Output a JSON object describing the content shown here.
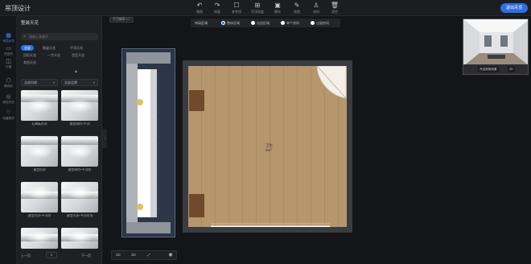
{
  "app": {
    "title": "吊顶设计"
  },
  "toolbar": {
    "tools": [
      {
        "label": "撤销",
        "icon": "undo-icon"
      },
      {
        "label": "恢复",
        "icon": "redo-icon"
      },
      {
        "label": "参考线",
        "icon": "guide-icon"
      },
      {
        "label": "吊顶高度",
        "icon": "height-icon"
      },
      {
        "label": "模块",
        "icon": "module-icon"
      },
      {
        "label": "绘图",
        "icon": "pencil-icon"
      },
      {
        "label": "房间",
        "icon": "user-icon"
      },
      {
        "label": "清空",
        "icon": "trash-icon"
      }
    ],
    "publish_label": "退出吊顶"
  },
  "rail": {
    "items": [
      {
        "label": "吊顶天花",
        "icon": "ceiling-icon",
        "active": true
      },
      {
        "label": "造型线",
        "icon": "molding-icon"
      },
      {
        "label": "灯槽",
        "icon": "lightslot-icon"
      },
      {
        "label": "模块库",
        "icon": "module-lib-icon"
      },
      {
        "label": "我的天花",
        "icon": "my-ceiling-icon"
      },
      {
        "label": "收藏素材",
        "icon": "favorites-icon"
      }
    ]
  },
  "panel": {
    "title": "整装天花",
    "search_placeholder": "请输入关键字",
    "categories": [
      "全部",
      "跌级天花",
      "平顶天花",
      "回形天花",
      "一字天花",
      "造型天花",
      "其他天花"
    ],
    "filters": [
      "全部风格",
      "全部品牌"
    ],
    "cards": [
      "石膏板吊顶",
      "造型简约+平顶",
      "造型吊顶",
      "造型简约+平顶吊",
      "造型吊顶+平顶吊",
      "造型吊顶+平顶吊顶",
      "",
      ""
    ],
    "pager": {
      "prev": "上一页",
      "page": "1",
      "next": "下一页"
    }
  },
  "canvas": {
    "hint": "吊顶编辑 3.0",
    "layout_bar": {
      "title": "布局区域",
      "options": [
        "整体区域",
        "自由区域",
        "单个房间",
        "过道房间"
      ],
      "selected": 0
    },
    "preview": {
      "view_button": "开启视角效果",
      "zoom": "3D"
    },
    "room": {
      "name": "卫生",
      "area": "9m²"
    },
    "bottom": {
      "items": [
        "2D",
        "3D",
        "⤢"
      ]
    }
  }
}
